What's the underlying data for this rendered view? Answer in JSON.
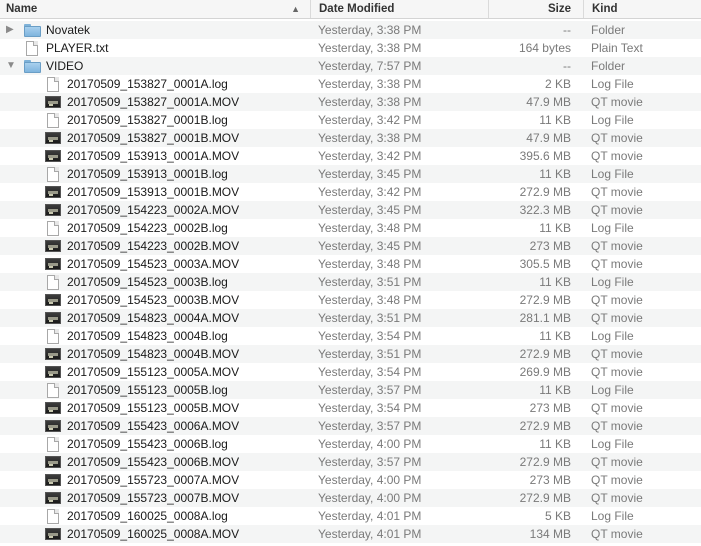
{
  "columns": {
    "name": "Name",
    "date": "Date Modified",
    "size": "Size",
    "kind": "Kind"
  },
  "sort_indicator": "▲",
  "rows": [
    {
      "level": 0,
      "disclosure": "▶",
      "icon": "folder-icon",
      "name": "Novatek",
      "date": "Yesterday, 3:38 PM",
      "size": "--",
      "kind": "Folder"
    },
    {
      "level": 0,
      "disclosure": "",
      "icon": "document-icon",
      "name": "PLAYER.txt",
      "date": "Yesterday, 3:38 PM",
      "size": "164 bytes",
      "kind": "Plain Text"
    },
    {
      "level": 0,
      "disclosure": "▼",
      "icon": "folder-icon",
      "name": "VIDEO",
      "date": "Yesterday, 7:57 PM",
      "size": "--",
      "kind": "Folder"
    },
    {
      "level": 1,
      "icon": "document-icon",
      "name": "20170509_153827_0001A.log",
      "date": "Yesterday, 3:38 PM",
      "size": "2 KB",
      "kind": "Log File"
    },
    {
      "level": 1,
      "icon": "movie-icon",
      "name": "20170509_153827_0001A.MOV",
      "date": "Yesterday, 3:38 PM",
      "size": "47.9 MB",
      "kind": "QT movie"
    },
    {
      "level": 1,
      "icon": "document-icon",
      "name": "20170509_153827_0001B.log",
      "date": "Yesterday, 3:42 PM",
      "size": "11 KB",
      "kind": "Log File"
    },
    {
      "level": 1,
      "icon": "movie-icon",
      "name": "20170509_153827_0001B.MOV",
      "date": "Yesterday, 3:38 PM",
      "size": "47.9 MB",
      "kind": "QT movie"
    },
    {
      "level": 1,
      "icon": "movie-icon",
      "name": "20170509_153913_0001A.MOV",
      "date": "Yesterday, 3:42 PM",
      "size": "395.6 MB",
      "kind": "QT movie"
    },
    {
      "level": 1,
      "icon": "document-icon",
      "name": "20170509_153913_0001B.log",
      "date": "Yesterday, 3:45 PM",
      "size": "11 KB",
      "kind": "Log File"
    },
    {
      "level": 1,
      "icon": "movie-icon",
      "name": "20170509_153913_0001B.MOV",
      "date": "Yesterday, 3:42 PM",
      "size": "272.9 MB",
      "kind": "QT movie"
    },
    {
      "level": 1,
      "icon": "movie-icon",
      "name": "20170509_154223_0002A.MOV",
      "date": "Yesterday, 3:45 PM",
      "size": "322.3 MB",
      "kind": "QT movie"
    },
    {
      "level": 1,
      "icon": "document-icon",
      "name": "20170509_154223_0002B.log",
      "date": "Yesterday, 3:48 PM",
      "size": "11 KB",
      "kind": "Log File"
    },
    {
      "level": 1,
      "icon": "movie-icon",
      "name": "20170509_154223_0002B.MOV",
      "date": "Yesterday, 3:45 PM",
      "size": "273 MB",
      "kind": "QT movie"
    },
    {
      "level": 1,
      "icon": "movie-icon",
      "name": "20170509_154523_0003A.MOV",
      "date": "Yesterday, 3:48 PM",
      "size": "305.5 MB",
      "kind": "QT movie"
    },
    {
      "level": 1,
      "icon": "document-icon",
      "name": "20170509_154523_0003B.log",
      "date": "Yesterday, 3:51 PM",
      "size": "11 KB",
      "kind": "Log File"
    },
    {
      "level": 1,
      "icon": "movie-icon",
      "name": "20170509_154523_0003B.MOV",
      "date": "Yesterday, 3:48 PM",
      "size": "272.9 MB",
      "kind": "QT movie"
    },
    {
      "level": 1,
      "icon": "movie-icon",
      "name": "20170509_154823_0004A.MOV",
      "date": "Yesterday, 3:51 PM",
      "size": "281.1 MB",
      "kind": "QT movie"
    },
    {
      "level": 1,
      "icon": "document-icon",
      "name": "20170509_154823_0004B.log",
      "date": "Yesterday, 3:54 PM",
      "size": "11 KB",
      "kind": "Log File"
    },
    {
      "level": 1,
      "icon": "movie-icon",
      "name": "20170509_154823_0004B.MOV",
      "date": "Yesterday, 3:51 PM",
      "size": "272.9 MB",
      "kind": "QT movie"
    },
    {
      "level": 1,
      "icon": "movie-icon",
      "name": "20170509_155123_0005A.MOV",
      "date": "Yesterday, 3:54 PM",
      "size": "269.9 MB",
      "kind": "QT movie"
    },
    {
      "level": 1,
      "icon": "document-icon",
      "name": "20170509_155123_0005B.log",
      "date": "Yesterday, 3:57 PM",
      "size": "11 KB",
      "kind": "Log File"
    },
    {
      "level": 1,
      "icon": "movie-icon",
      "name": "20170509_155123_0005B.MOV",
      "date": "Yesterday, 3:54 PM",
      "size": "273 MB",
      "kind": "QT movie"
    },
    {
      "level": 1,
      "icon": "movie-icon",
      "name": "20170509_155423_0006A.MOV",
      "date": "Yesterday, 3:57 PM",
      "size": "272.9 MB",
      "kind": "QT movie"
    },
    {
      "level": 1,
      "icon": "document-icon",
      "name": "20170509_155423_0006B.log",
      "date": "Yesterday, 4:00 PM",
      "size": "11 KB",
      "kind": "Log File"
    },
    {
      "level": 1,
      "icon": "movie-icon",
      "name": "20170509_155423_0006B.MOV",
      "date": "Yesterday, 3:57 PM",
      "size": "272.9 MB",
      "kind": "QT movie"
    },
    {
      "level": 1,
      "icon": "movie-icon",
      "name": "20170509_155723_0007A.MOV",
      "date": "Yesterday, 4:00 PM",
      "size": "273 MB",
      "kind": "QT movie"
    },
    {
      "level": 1,
      "icon": "movie-icon",
      "name": "20170509_155723_0007B.MOV",
      "date": "Yesterday, 4:00 PM",
      "size": "272.9 MB",
      "kind": "QT movie"
    },
    {
      "level": 1,
      "icon": "document-icon",
      "name": "20170509_160025_0008A.log",
      "date": "Yesterday, 4:01 PM",
      "size": "5 KB",
      "kind": "Log File"
    },
    {
      "level": 1,
      "icon": "movie-icon",
      "name": "20170509_160025_0008A.MOV",
      "date": "Yesterday, 4:01 PM",
      "size": "134 MB",
      "kind": "QT movie"
    }
  ]
}
